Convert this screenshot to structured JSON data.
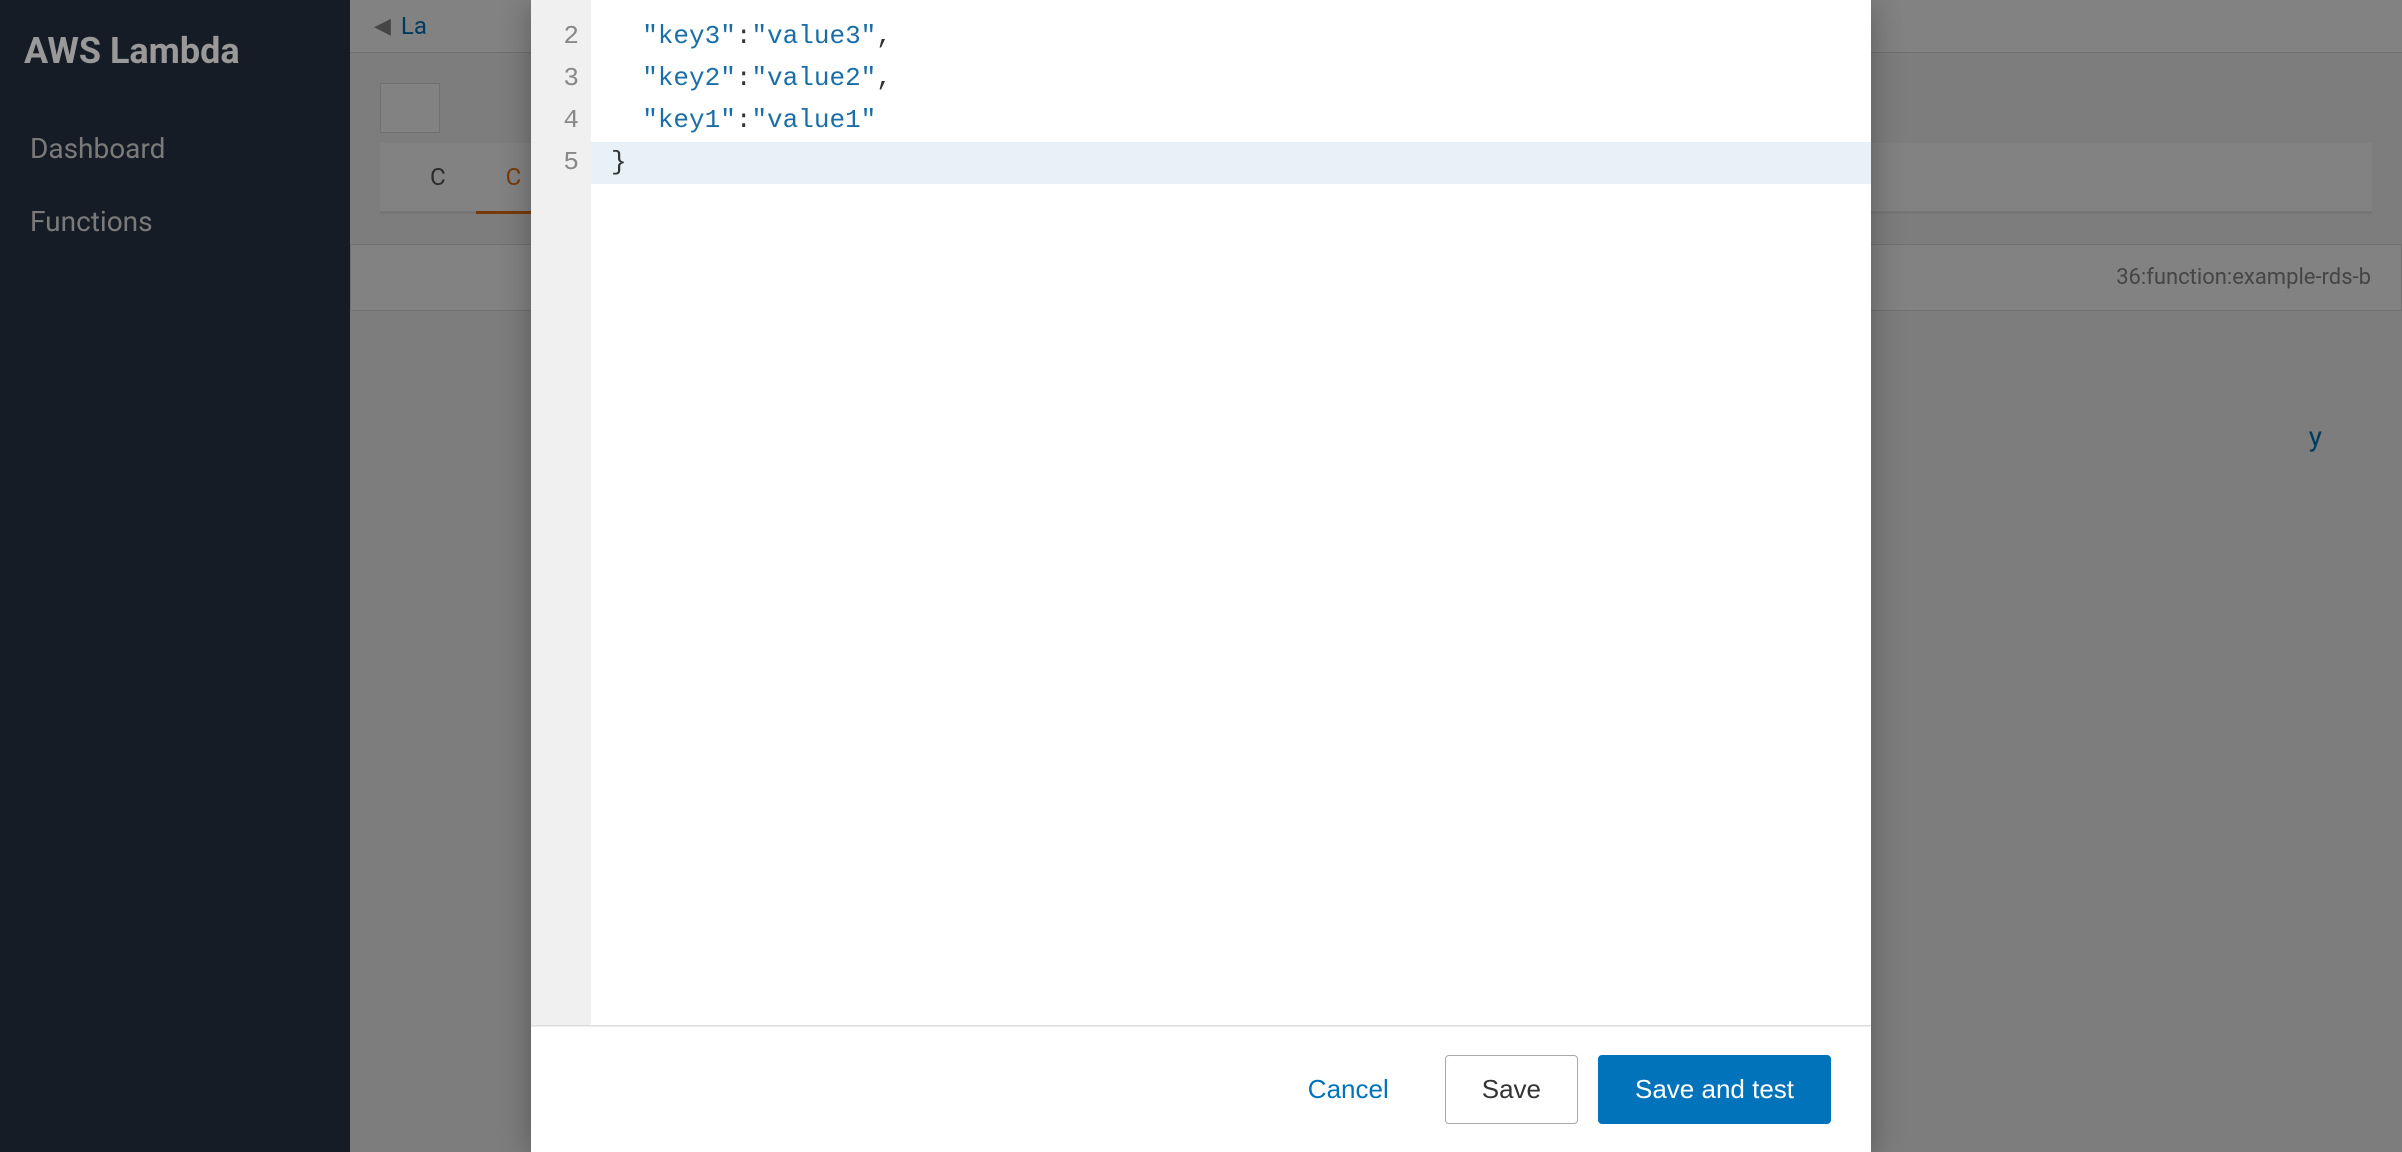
{
  "app": {
    "title": "AWS Lambda"
  },
  "sidebar": {
    "logo": "AWS Lambda",
    "nav_items": [
      {
        "label": "Dashboard",
        "active": false
      },
      {
        "label": "Functions",
        "active": true
      }
    ]
  },
  "breadcrumb": {
    "link_text": "La",
    "arrow": "◀",
    "function_partial": "36:function:example-rds-b"
  },
  "tabs": [
    {
      "label": "C",
      "active": false
    },
    {
      "label": "C",
      "active": true
    }
  ],
  "policy_link": "y",
  "code_editor": {
    "lines": [
      {
        "num": 2,
        "content": "  \"key3\": \"value3\","
      },
      {
        "num": 3,
        "content": "  \"key2\": \"value2\","
      },
      {
        "num": 4,
        "content": "  \"key1\": \"value1\""
      },
      {
        "num": 5,
        "content": "}",
        "highlighted": true
      }
    ]
  },
  "modal_footer": {
    "cancel_label": "Cancel",
    "save_label": "Save",
    "save_test_label": "Save and test"
  }
}
